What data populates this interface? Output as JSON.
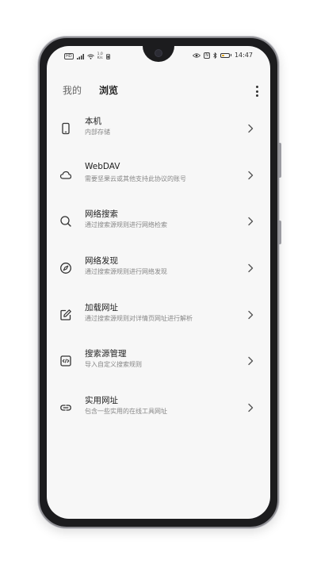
{
  "status_bar": {
    "hd_badge": "HD",
    "speed_value": "1.0",
    "speed_unit": "K/s",
    "nfc_badge": "N",
    "battery_level": 0.35,
    "time": "14:47"
  },
  "header": {
    "tabs": [
      {
        "label": "我的"
      },
      {
        "label": "浏览"
      }
    ],
    "menu_icon": "more-vertical-icon"
  },
  "list": {
    "items": [
      {
        "title": "本机",
        "subtitle": "内部存储",
        "icon": "phone-icon"
      },
      {
        "title": "WebDAV",
        "subtitle": "需要坚果云或其他支持此协议的账号",
        "icon": "cloud-icon"
      },
      {
        "title": "网络搜索",
        "subtitle": "通过搜索源规则进行网络检索",
        "icon": "search-icon"
      },
      {
        "title": "网络发现",
        "subtitle": "通过搜索源规则进行网络发现",
        "icon": "compass-icon"
      },
      {
        "title": "加载网址",
        "subtitle": "通过搜索源规则对详情页网址进行解析",
        "icon": "edit-icon"
      },
      {
        "title": "搜索源管理",
        "subtitle": "导入自定义搜索规则",
        "icon": "code-icon"
      },
      {
        "title": "实用网址",
        "subtitle": "包含一些实用的在线工具网址",
        "icon": "link-icon"
      }
    ]
  },
  "colors": {
    "background": "#f7f7f7",
    "text_primary": "#222222",
    "text_secondary": "#888888",
    "battery_accent": "#e0a000"
  }
}
